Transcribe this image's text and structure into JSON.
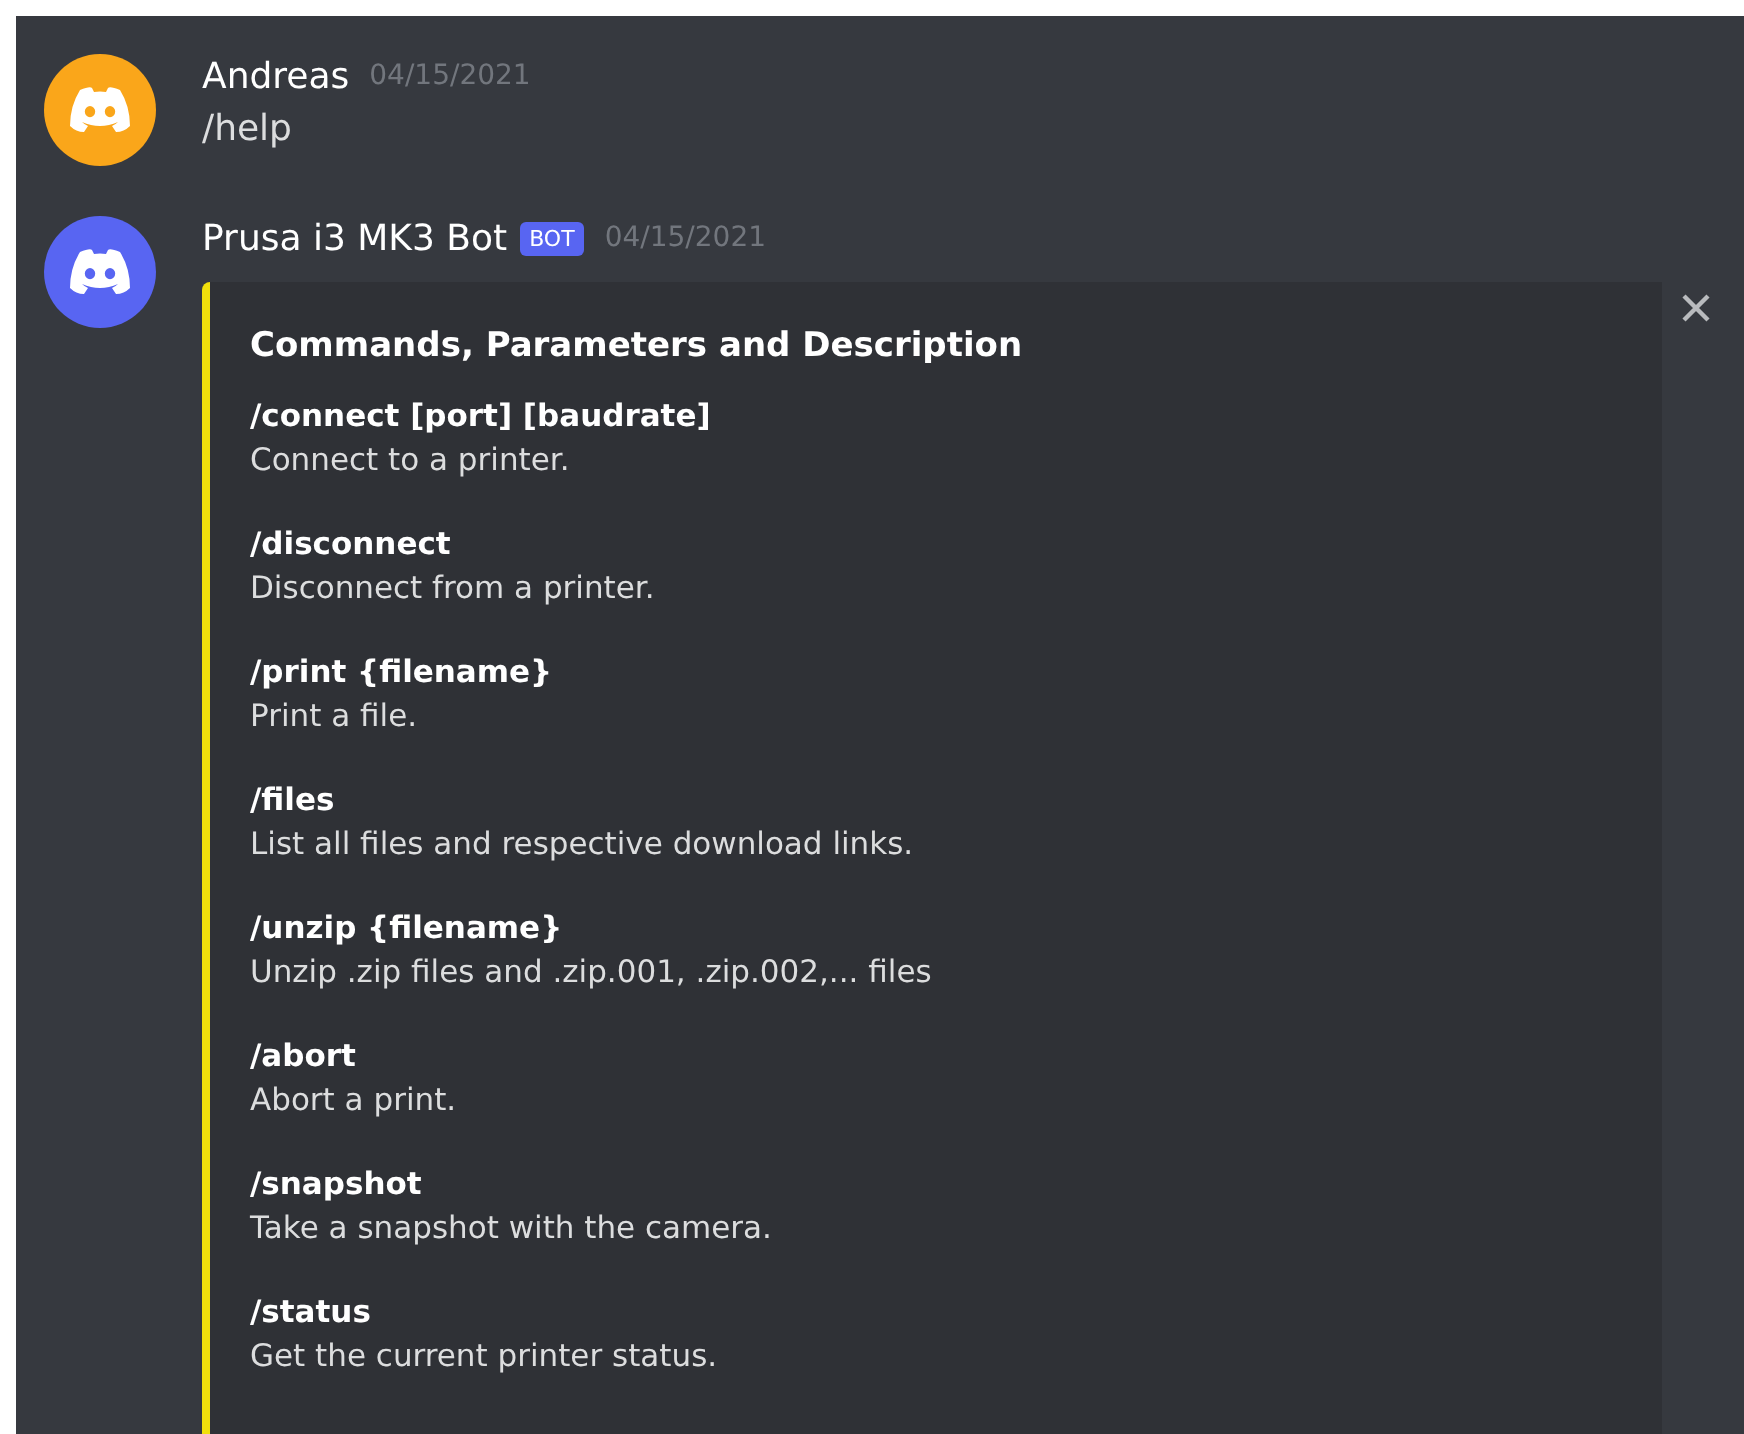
{
  "messages": [
    {
      "author": "Andreas",
      "color": "#faa61a",
      "timestamp": "04/15/2021",
      "text": "/help"
    },
    {
      "author": "Prusa i3 MK3 Bot",
      "color": "#5865f2",
      "badge": "BOT",
      "timestamp": "04/15/2021",
      "embed": {
        "title": "Commands, Parameters and Description",
        "fields": [
          {
            "name": "/connect [port] [baudrate]",
            "value": "Connect to a printer."
          },
          {
            "name": "/disconnect",
            "value": "Disconnect from a printer."
          },
          {
            "name": "/print {filename}",
            "value": "Print a file."
          },
          {
            "name": "/files",
            "value": "List all files and respective download links."
          },
          {
            "name": "/unzip {filename}",
            "value": "Unzip .zip files and .zip.001, .zip.002,... files"
          },
          {
            "name": "/abort",
            "value": "Abort a print."
          },
          {
            "name": "/snapshot",
            "value": "Take a snapshot with the camera."
          },
          {
            "name": "/status",
            "value": "Get the current printer status."
          }
        ]
      }
    }
  ]
}
